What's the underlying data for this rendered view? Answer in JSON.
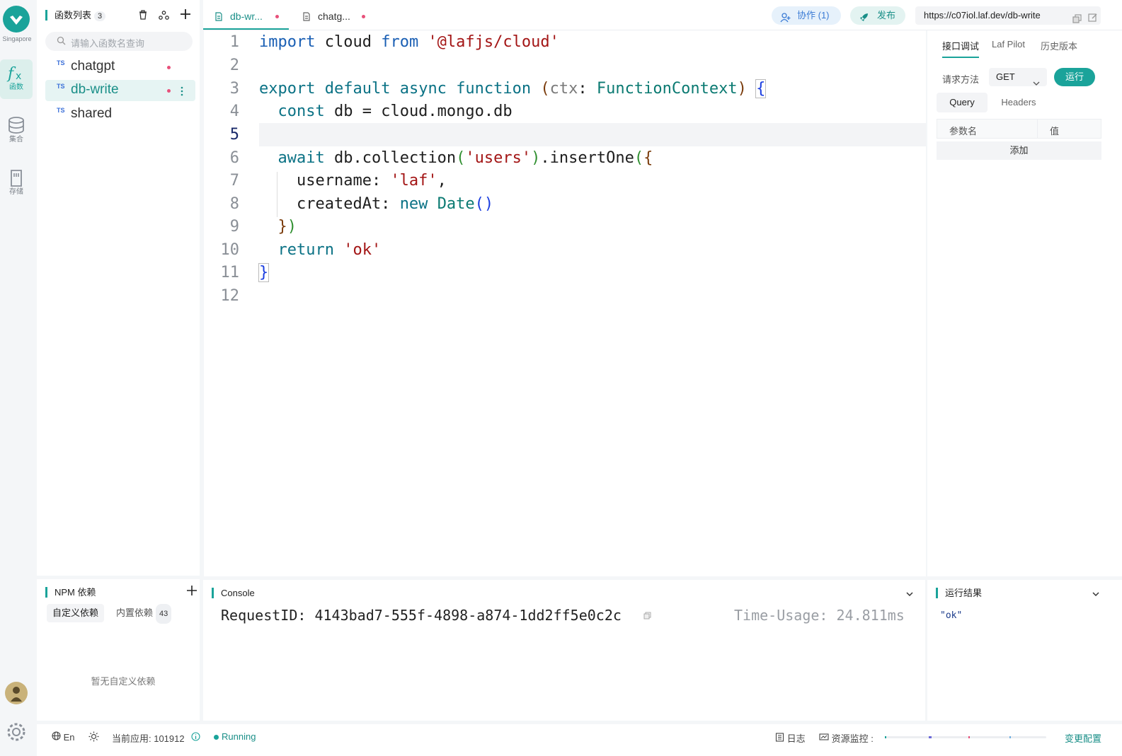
{
  "rail": {
    "region": "Singapore",
    "items": [
      {
        "label": "函数",
        "icon": "function-icon"
      },
      {
        "label": "集合",
        "icon": "database-icon"
      },
      {
        "label": "存储",
        "icon": "storage-icon"
      }
    ]
  },
  "functions": {
    "title": "函数列表",
    "count": "3",
    "search_placeholder": "请输入函数名查询",
    "items": [
      {
        "type": "TS",
        "name": "chatgpt"
      },
      {
        "type": "TS",
        "name": "db-write"
      },
      {
        "type": "TS",
        "name": "shared"
      }
    ]
  },
  "npm": {
    "title": "NPM 依赖",
    "tab_custom": "自定义依赖",
    "tab_builtin": "内置依赖",
    "builtin_count": "43",
    "empty": "暂无自定义依赖"
  },
  "tabs": [
    {
      "label": "db-wr..."
    },
    {
      "label": "chatg..."
    }
  ],
  "header": {
    "collab": "协作 (1)",
    "publish": "发布",
    "url": "https://c07iol.laf.dev/db-write"
  },
  "editor": {
    "lines": [
      "1",
      "2",
      "3",
      "4",
      "5",
      "6",
      "7",
      "8",
      "9",
      "10",
      "11",
      "12"
    ]
  },
  "debug": {
    "tabs": [
      "接口调试",
      "Laf Pilot",
      "历史版本"
    ],
    "method_label": "请求方法",
    "method": "GET",
    "run": "运行",
    "subtabs": [
      "Query",
      "Headers"
    ],
    "col_name": "参数名",
    "col_value": "值",
    "add": "添加"
  },
  "console": {
    "title": "Console",
    "request_id": "RequestID: 4143bad7-555f-4898-a874-1dd2ff5e0c2c",
    "time_usage": "Time-Usage: 24.811ms"
  },
  "result": {
    "title": "运行结果",
    "value": "\"ok\""
  },
  "statusbar": {
    "lang": "En",
    "current_app": "当前应用: 101912",
    "status": "Running",
    "logs": "日志",
    "monitor": "资源监控 :",
    "change_config": "变更配置"
  },
  "colors": {
    "accent": "#1aa39a",
    "dirty_dot": "#e8507a"
  }
}
